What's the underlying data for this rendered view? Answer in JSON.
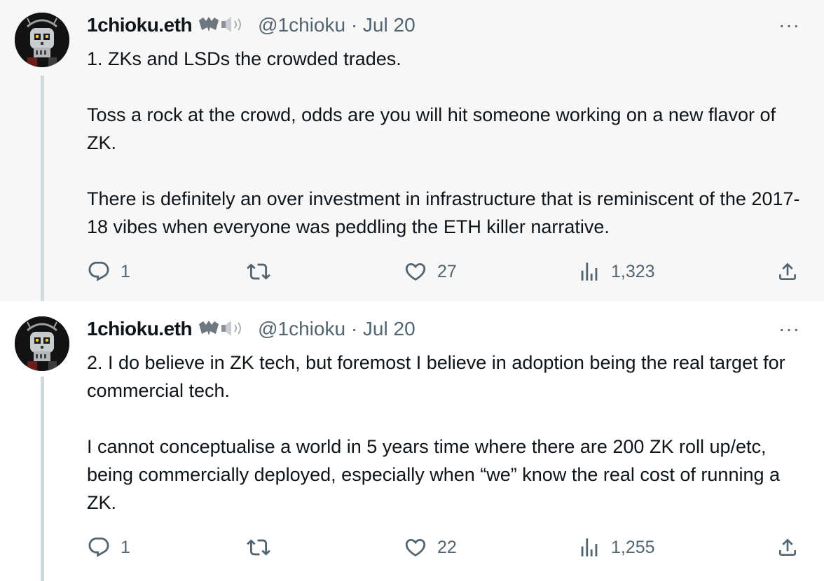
{
  "tweets": [
    {
      "author_name": "1chioku.eth",
      "author_emoji": "bat-speaker-emoji",
      "handle": "@1chioku",
      "separator": "·",
      "date": "Jul 20",
      "more_label": "···",
      "paragraphs": [
        "1. ZKs and LSDs the crowded trades.",
        "Toss a rock at the crowd, odds are you will hit someone working on a new flavor of ZK.",
        "There is definitely an over investment in infrastructure that is reminiscent of the 2017-18 vibes when everyone was peddling the ETH killer narrative."
      ],
      "reply_count": "1",
      "retweet_count": "",
      "like_count": "27",
      "views_count": "1,323"
    },
    {
      "author_name": "1chioku.eth",
      "author_emoji": "bat-speaker-emoji",
      "handle": "@1chioku",
      "separator": "·",
      "date": "Jul 20",
      "more_label": "···",
      "paragraphs": [
        "2. I do believe in ZK tech, but foremost I believe in adoption being the real target for commercial tech.",
        "I cannot conceptualise a world in 5 years time where there are 200 ZK roll up/etc, being commercially deployed, especially when “we” know the real cost of running a ZK."
      ],
      "reply_count": "1",
      "retweet_count": "",
      "like_count": "22",
      "views_count": "1,255"
    }
  ],
  "colors": {
    "text_primary": "#0f1419",
    "text_secondary": "#536471",
    "thread_line": "#cfd9de",
    "highlight_background": "#f7f7f7"
  }
}
